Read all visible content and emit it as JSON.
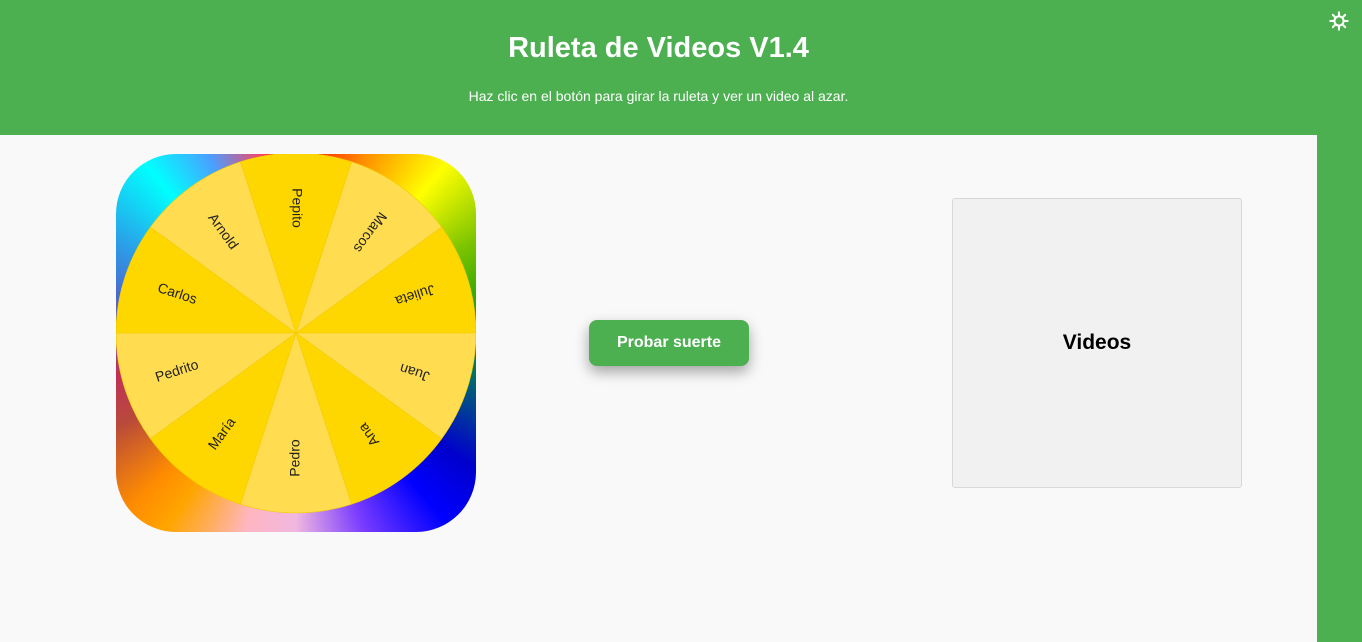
{
  "header": {
    "title": "Ruleta de Videos V1.4",
    "subtitle": "Haz clic en el botón para girar la ruleta y ver un video al azar."
  },
  "settings": {
    "icon": "gear-icon"
  },
  "wheel": {
    "segments": [
      "Pepito",
      "Marcos",
      "Julieta",
      "Juan",
      "Ana",
      "Pedro",
      "María",
      "Pedrito",
      "Carlos",
      "Arnold"
    ],
    "colors": [
      "#ffd700",
      "#ffdc50"
    ]
  },
  "spin_button": {
    "label": "Probar suerte"
  },
  "videos_panel": {
    "label": "Videos"
  },
  "colors": {
    "accent": "#4caf50",
    "background": "#f9f9f9"
  }
}
